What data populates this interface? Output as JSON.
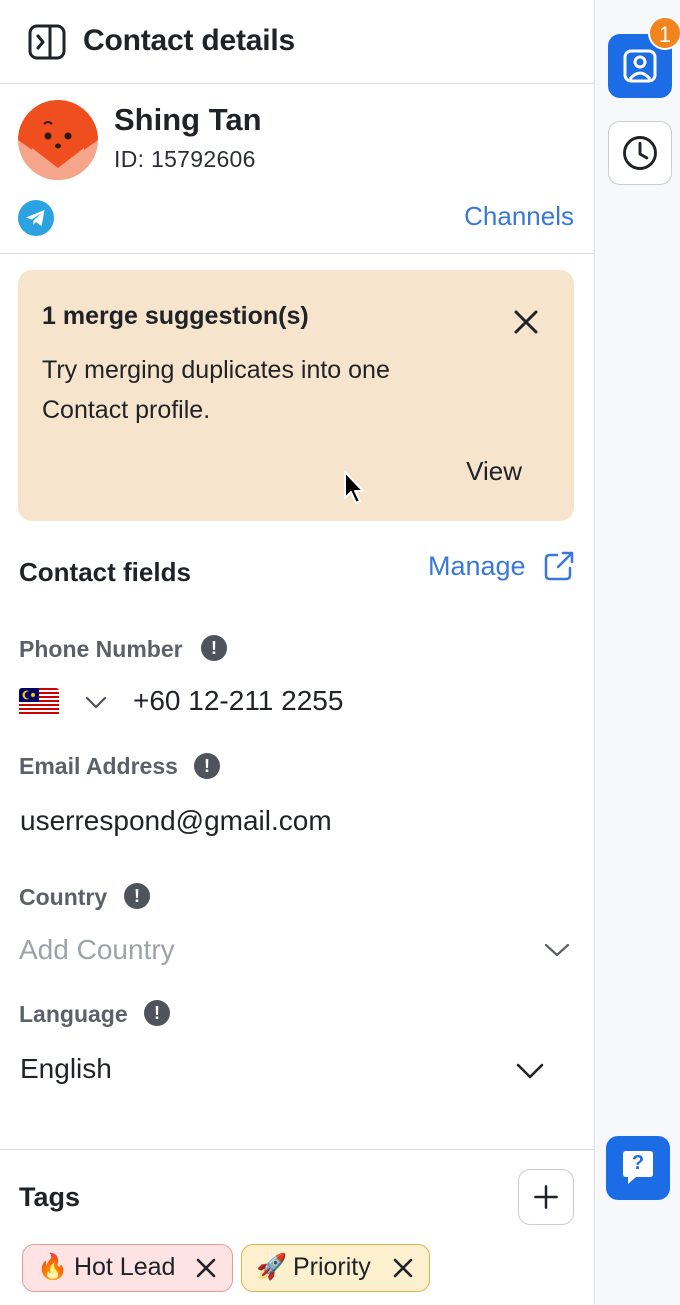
{
  "header": {
    "title": "Contact details",
    "collapse_icon": "panel-collapse-icon"
  },
  "contact": {
    "name": "Shing Tan",
    "id_text": "ID: 15792606",
    "avatar_icon": "fox-avatar",
    "channel_icon": "telegram-icon",
    "channels_label": "Channels"
  },
  "merge_suggestion": {
    "title": "1 merge suggestion(s)",
    "text": "Try merging duplicates into one Contact profile.",
    "view_label": "View",
    "background": "#f7e4cc"
  },
  "contact_fields": {
    "title": "Contact fields",
    "manage_label": "Manage",
    "phone": {
      "label": "Phone Number",
      "country_flag": "malaysia-flag",
      "value": "+60 12-211 2255"
    },
    "email": {
      "label": "Email Address",
      "value": "userrespond@gmail.com"
    },
    "country": {
      "label": "Country",
      "placeholder": "Add Country"
    },
    "language": {
      "label": "Language",
      "value": "English"
    },
    "info_glyph": "!"
  },
  "tags": {
    "title": "Tags",
    "add_icon": "plus-icon",
    "items": [
      {
        "emoji": "🔥",
        "label": "Hot Lead",
        "color": "#fde3e3"
      },
      {
        "emoji": "🚀",
        "label": "Priority",
        "color": "#fdf0cf"
      }
    ]
  },
  "rail": {
    "contact_badge": "1",
    "help_glyph": "?"
  },
  "colors": {
    "accent": "#1c6ce6",
    "link": "#3a78d8",
    "badge": "#f2841e"
  }
}
